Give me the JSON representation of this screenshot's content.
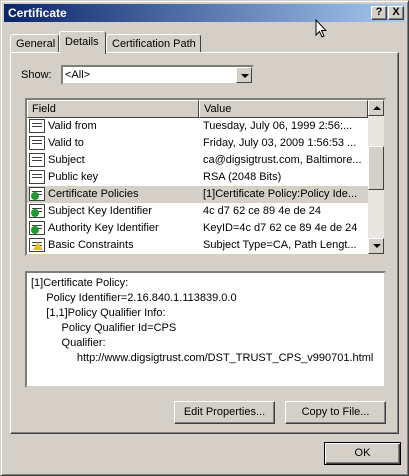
{
  "window": {
    "title": "Certificate",
    "help_glyph": "?",
    "close_glyph": "X"
  },
  "tabs": [
    {
      "label": "General",
      "active": false
    },
    {
      "label": "Details",
      "active": true
    },
    {
      "label": "Certification Path",
      "active": false
    }
  ],
  "show": {
    "label": "Show:",
    "value": "<All>"
  },
  "list": {
    "columns": [
      "Field",
      "Value"
    ],
    "rows": [
      {
        "field": "Valid from",
        "value": "Tuesday, July 06, 1999 2:56:...",
        "icon": "doc-field-icon",
        "selected": false
      },
      {
        "field": "Valid to",
        "value": "Friday, July 03, 2009 1:56:53 ...",
        "icon": "doc-field-icon",
        "selected": false
      },
      {
        "field": "Subject",
        "value": "ca@digsigtrust.com, Baltimore...",
        "icon": "doc-field-icon",
        "selected": false
      },
      {
        "field": "Public key",
        "value": "RSA (2048 Bits)",
        "icon": "doc-field-icon",
        "selected": false
      },
      {
        "field": "Certificate Policies",
        "value": "[1]Certificate Policy:Policy Ide...",
        "icon": "extension-icon",
        "selected": true
      },
      {
        "field": "Subject Key Identifier",
        "value": "4c d7 62 ce 89 4e de 24",
        "icon": "extension-icon",
        "selected": false
      },
      {
        "field": "Authority Key Identifier",
        "value": "KeyID=4c d7 62 ce 89 4e de 24",
        "icon": "extension-icon",
        "selected": false
      },
      {
        "field": "Basic Constraints",
        "value": "Subject Type=CA, Path Lengt...",
        "icon": "critical-extension-icon",
        "selected": false
      }
    ]
  },
  "detail": {
    "lines": [
      "[1]Certificate Policy:",
      "     Policy Identifier=2.16.840.1.113839.0.0",
      "     [1,1]Policy Qualifier Info:",
      "          Policy Qualifier Id=CPS",
      "          Qualifier:",
      "               http://www.digsigtrust.com/DST_TRUST_CPS_v990701.html"
    ]
  },
  "buttons": {
    "edit_properties": "Edit Properties...",
    "copy_to_file": "Copy to File...",
    "ok": "OK"
  }
}
